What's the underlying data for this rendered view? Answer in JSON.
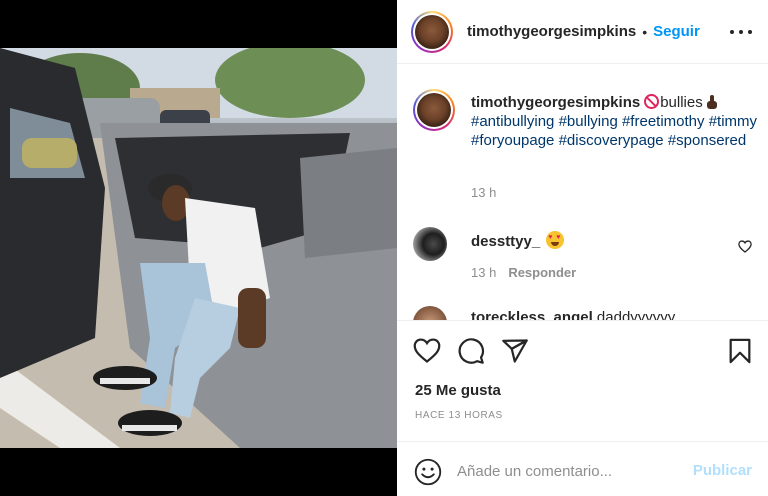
{
  "post": {
    "photo_alt_icon": "photo-car-person",
    "header": {
      "username": "timothygeorgesimpkins",
      "separator": "•",
      "follow_label": "Seguir",
      "more_icon": "more-horizontal-icon"
    },
    "caption": {
      "username": "timothygeorgesimpkins",
      "text_after_emoji": "bullies",
      "hashtags": [
        "#antibullying",
        "#bullying",
        "#freetimothy",
        "#timmy",
        "#foryoupage",
        "#discoverypage",
        "#sponsered"
      ],
      "time": "13 h"
    },
    "comments": [
      {
        "username": "dessttyy_",
        "time": "13 h",
        "reply_label": "Responder"
      },
      {
        "username": "toreckless_angel",
        "text": "daddyyyyyy"
      }
    ],
    "likes": "25 Me gusta",
    "post_time": "HACE 13 HORAS",
    "comment_box": {
      "placeholder": "Añade un comentario...",
      "publish_label": "Publicar"
    },
    "colors": {
      "accent": "#0095f6",
      "hashtag": "#00376b",
      "muted": "#8e8e8e",
      "publish_disabled": "#b2dffc"
    }
  }
}
